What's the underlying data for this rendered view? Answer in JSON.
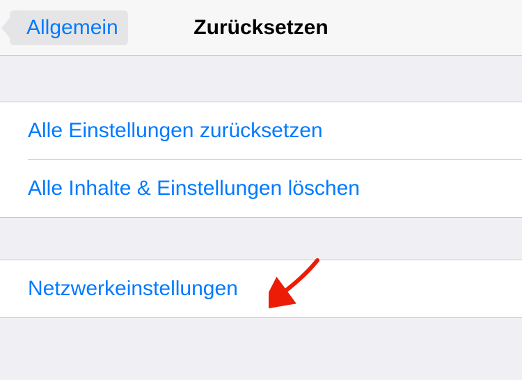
{
  "navbar": {
    "back_label": "Allgemein",
    "title": "Zurücksetzen"
  },
  "groups": [
    {
      "items": [
        {
          "label": "Alle Einstellungen zurücksetzen"
        },
        {
          "label": "Alle Inhalte & Einstellungen löschen"
        }
      ]
    },
    {
      "items": [
        {
          "label": "Netzwerkeinstellungen"
        }
      ]
    }
  ],
  "colors": {
    "link": "#007aff",
    "background": "#efeff4",
    "separator": "#c8c7cc",
    "arrow": "#ec1c07"
  }
}
